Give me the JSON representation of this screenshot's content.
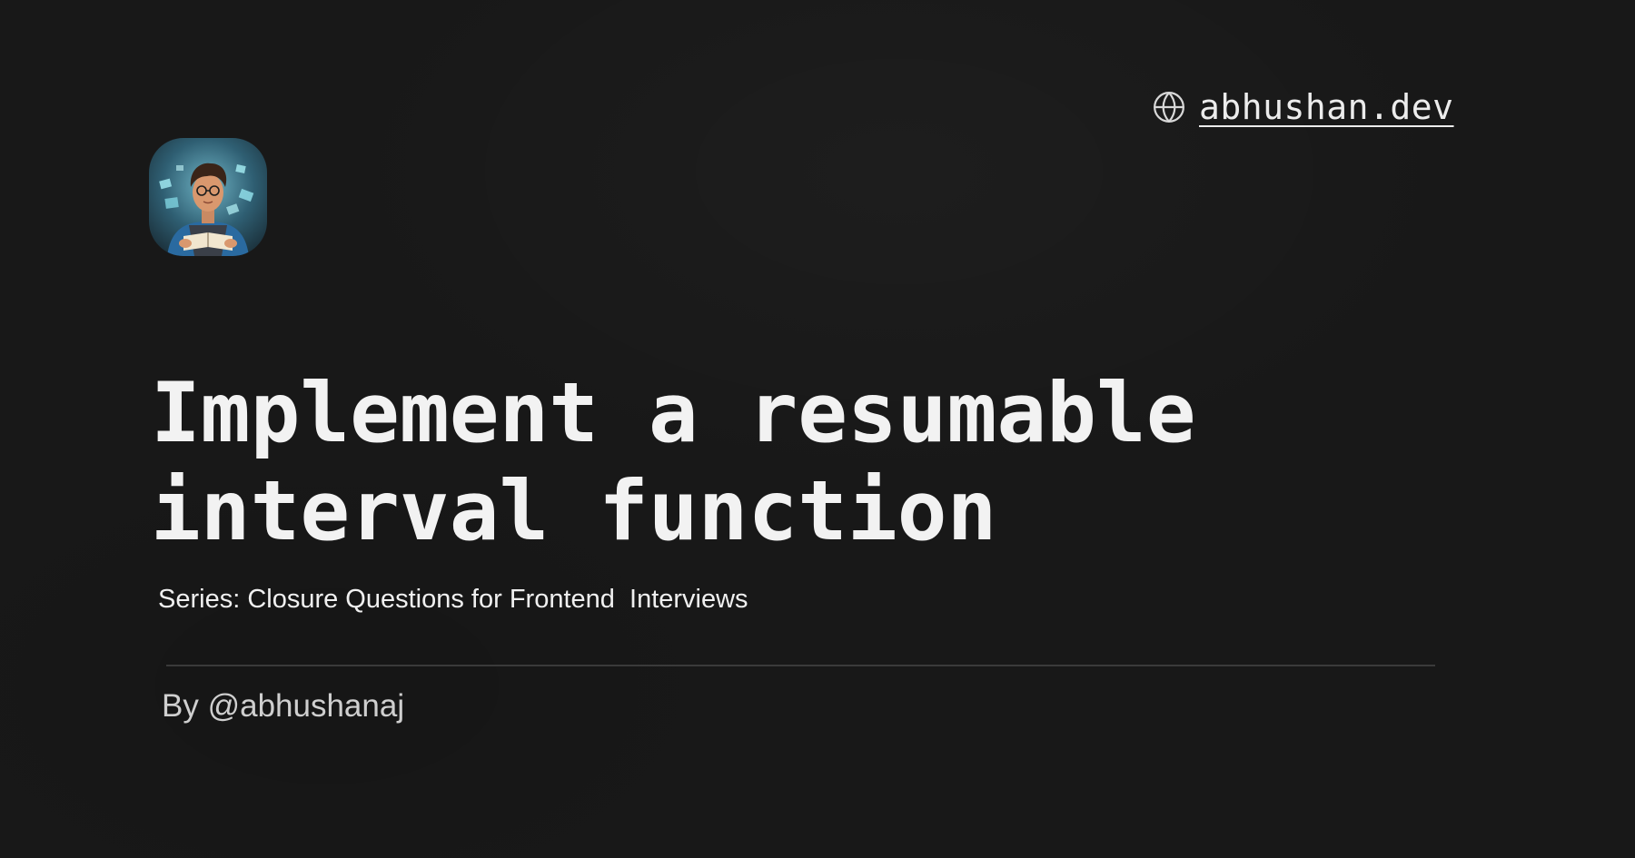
{
  "site": {
    "domain": "abhushan.dev",
    "icon": "globe-icon"
  },
  "avatar": {
    "icon": "avatar-illustration"
  },
  "post": {
    "title_line_1": "Implement a resumable",
    "title_line_2": "interval function",
    "series": "Series: Closure Questions for Frontend  Interviews",
    "byline": "By @abhushanaj"
  },
  "colors": {
    "background": "#181818",
    "title": "#f2f2f2",
    "divider": "#3a3a3a"
  }
}
